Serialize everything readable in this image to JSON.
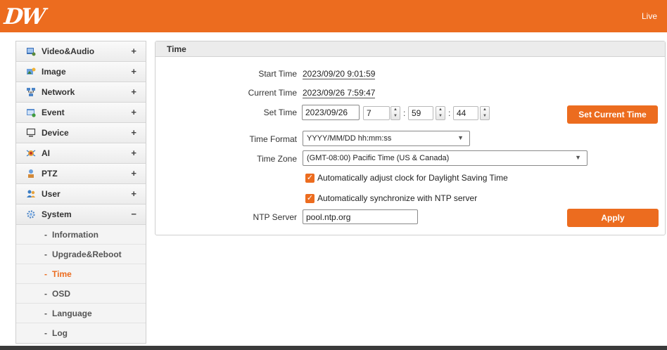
{
  "header": {
    "logo": "DW",
    "live_label": "Live"
  },
  "sidebar": {
    "items": [
      {
        "label": "Video&Audio",
        "toggle": "+"
      },
      {
        "label": "Image",
        "toggle": "+"
      },
      {
        "label": "Network",
        "toggle": "+"
      },
      {
        "label": "Event",
        "toggle": "+"
      },
      {
        "label": "Device",
        "toggle": "+"
      },
      {
        "label": "AI",
        "toggle": "+"
      },
      {
        "label": "PTZ",
        "toggle": "+"
      },
      {
        "label": "User",
        "toggle": "+"
      },
      {
        "label": "System",
        "toggle": "−"
      }
    ],
    "sub_items": [
      {
        "label": "Information"
      },
      {
        "label": "Upgrade&Reboot"
      },
      {
        "label": "Time"
      },
      {
        "label": "OSD"
      },
      {
        "label": "Language"
      },
      {
        "label": "Log"
      }
    ],
    "active_sub": "Time",
    "accent_color": "#ec6c1f"
  },
  "panel": {
    "title": "Time",
    "start_time_label": "Start Time",
    "start_time_value": "2023/09/20 9:01:59",
    "current_time_label": "Current Time",
    "current_time_value": "2023/09/26 7:59:47",
    "set_time_label": "Set Time",
    "set_date": "2023/09/26",
    "set_hour": "7",
    "set_minute": "59",
    "set_second": "44",
    "colon": ":",
    "set_current_time_button": "Set Current Time",
    "time_format_label": "Time Format",
    "time_format_value": "YYYY/MM/DD hh:mm:ss",
    "time_zone_label": "Time Zone",
    "time_zone_value": "(GMT-08:00) Pacific Time (US & Canada)",
    "dst_label": "Automatically adjust clock for Daylight Saving Time",
    "dst_checked": true,
    "ntp_sync_label": "Automatically synchronize with NTP server",
    "ntp_sync_checked": true,
    "ntp_server_label": "NTP Server",
    "ntp_server_value": "pool.ntp.org",
    "apply_button": "Apply"
  }
}
